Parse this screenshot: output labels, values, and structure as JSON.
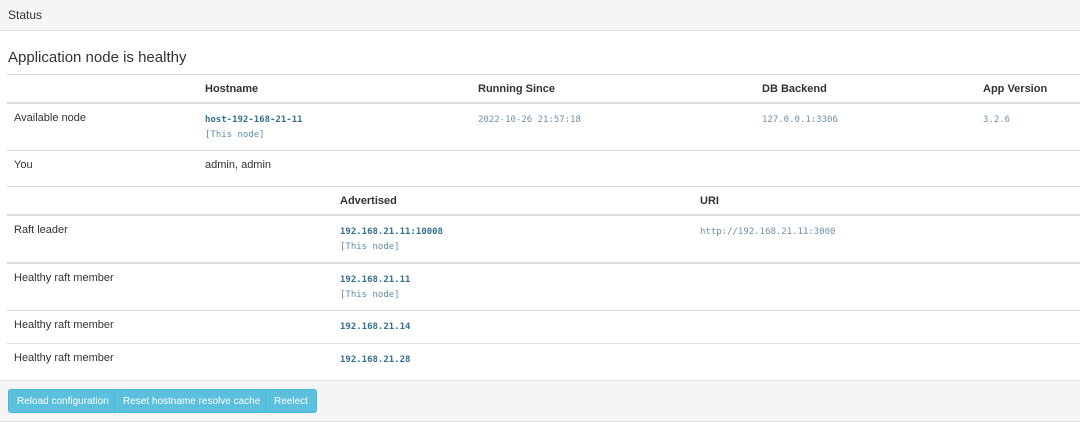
{
  "header": {
    "title": "Status"
  },
  "main": {
    "heading": "Application node is healthy",
    "node_table": {
      "columns": [
        "",
        "Hostname",
        "Running Since",
        "DB Backend",
        "App Version"
      ],
      "available_node": {
        "label": "Available node",
        "hostname": "host-192-168-21-11",
        "this_node": "[This node]",
        "running_since": "2022-10-26 21:57:18",
        "db_backend": "127.0.0.1:3306",
        "app_version": "3.2.6"
      },
      "you": {
        "label": "You",
        "value": "admin, admin"
      }
    },
    "raft_table": {
      "columns": [
        "",
        "Advertised",
        "URI"
      ],
      "rows": [
        {
          "label": "Raft leader",
          "advertised": "192.168.21.11:10008",
          "note": "[This node]",
          "uri": "http://192.168.21.11:3000"
        },
        {
          "label": "Healthy raft member",
          "advertised": "192.168.21.11",
          "note": "[This node]",
          "uri": ""
        },
        {
          "label": "Healthy raft member",
          "advertised": "192.168.21.14",
          "note": "",
          "uri": ""
        },
        {
          "label": "Healthy raft member",
          "advertised": "192.168.21.28",
          "note": "",
          "uri": ""
        }
      ]
    }
  },
  "footer": {
    "buttons": [
      "Reload configuration",
      "Reset hostname resolve cache",
      "Reelect"
    ],
    "button_color": "#5bc0de"
  }
}
